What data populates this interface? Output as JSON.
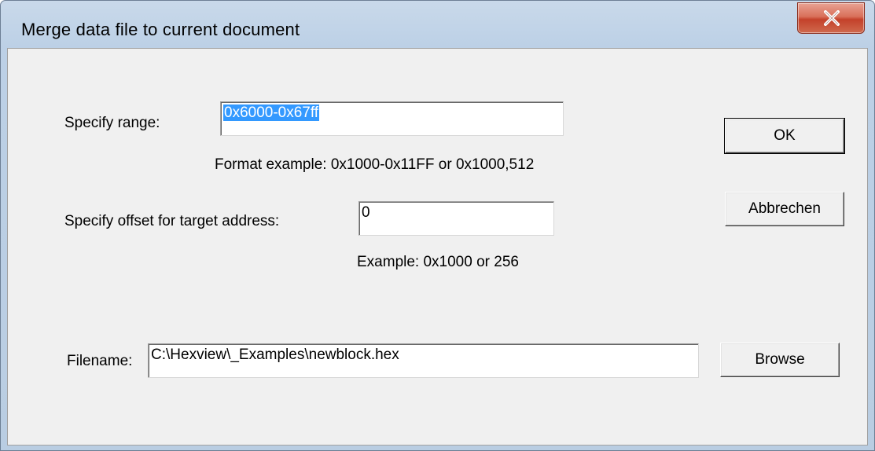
{
  "window": {
    "title": "Merge data file to current document"
  },
  "form": {
    "range_label": "Specify range:",
    "range_value": "0x6000-0x67ff",
    "range_hint": "Format example: 0x1000-0x11FF or 0x1000,512",
    "offset_label": "Specify offset for target address:",
    "offset_value": "0",
    "offset_hint": "Example:  0x1000 or 256",
    "filename_label": "Filename:",
    "filename_value": "C:\\Hexview\\_Examples\\newblock.hex"
  },
  "buttons": {
    "ok": "OK",
    "cancel": "Abbrechen",
    "browse": "Browse"
  },
  "icons": {
    "close": "close-icon"
  },
  "colors": {
    "selection": "#3399ff",
    "close_button": "#c4412a",
    "frame": "#bcd0e6",
    "client": "#f0f0f0"
  }
}
